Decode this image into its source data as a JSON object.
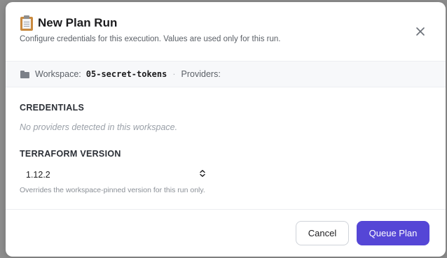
{
  "modal": {
    "title": "New Plan Run",
    "subtitle": "Configure credentials for this execution. Values are used only for this run.",
    "title_icon": "clipboard-icon",
    "close_icon": "close-icon"
  },
  "context": {
    "workspace_label": "Workspace:",
    "workspace_value": "05-secret-tokens",
    "separator": "·",
    "providers_label": "Providers:",
    "folder_icon": "folder-icon"
  },
  "credentials": {
    "heading": "CREDENTIALS",
    "empty_text": "No providers detected in this workspace."
  },
  "terraform": {
    "heading": "TERRAFORM VERSION",
    "selected_version": "1.12.2",
    "hint": "Overrides the workspace-pinned version for this run only."
  },
  "footer": {
    "cancel_label": "Cancel",
    "submit_label": "Queue Plan"
  },
  "colors": {
    "accent": "#5546d6",
    "backdrop": "#8d8d8d"
  }
}
